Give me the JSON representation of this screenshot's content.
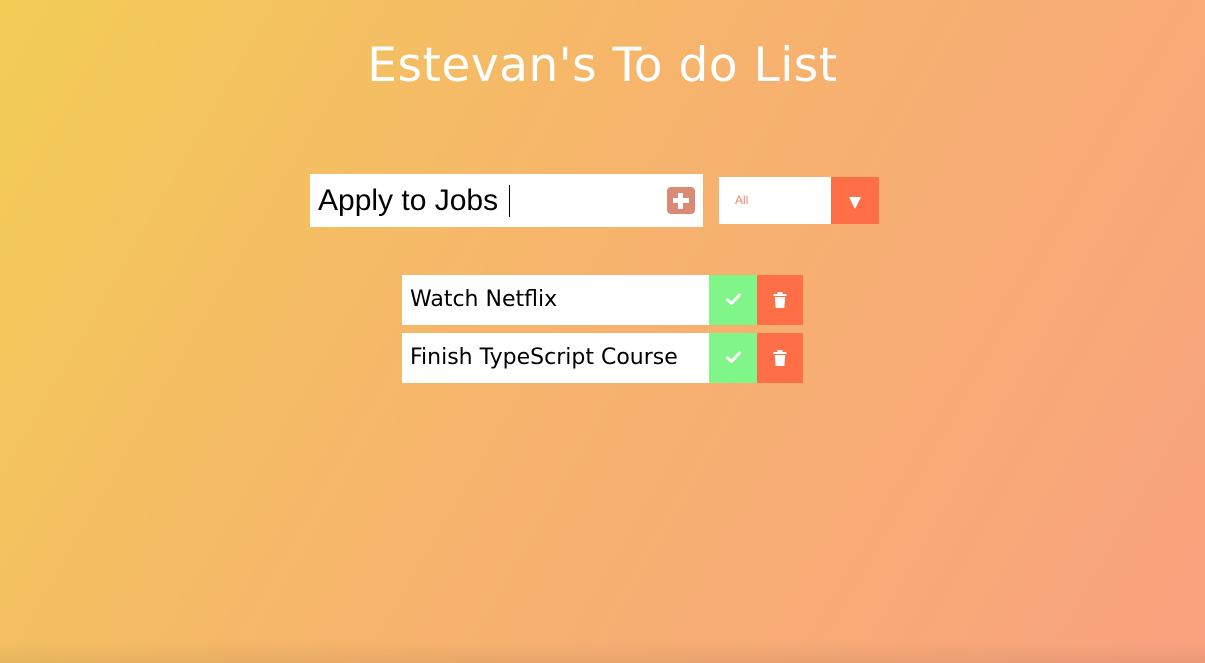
{
  "header": {
    "title": "Estevan's To do List"
  },
  "form": {
    "input_value": "Apply to Jobs",
    "add_icon": "plus-square-icon"
  },
  "filter": {
    "selected": "All",
    "arrow_icon": "triangle-down-icon"
  },
  "todos": [
    {
      "text": "Watch Netflix",
      "complete_icon": "check-icon",
      "delete_icon": "trash-icon"
    },
    {
      "text": "Finish TypeScript Course",
      "complete_icon": "check-icon",
      "delete_icon": "trash-icon"
    }
  ],
  "colors": {
    "gradient_start": "#f2cd55",
    "gradient_end": "#f9a27f",
    "add_button": "#d88a74",
    "accent": "#ff6f47",
    "complete": "#80f688",
    "filter_text": "#f5876c"
  }
}
